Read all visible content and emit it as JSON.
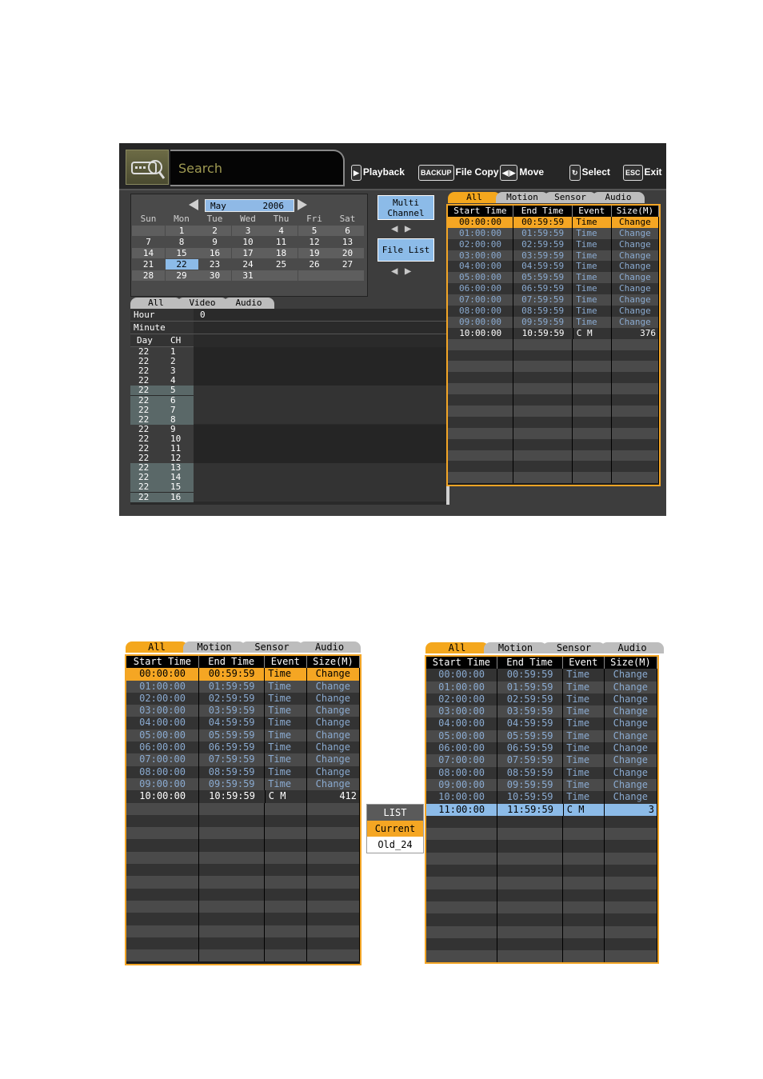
{
  "header": {
    "title": "Search",
    "hints": [
      {
        "key": "▶",
        "label": "Playback"
      },
      {
        "key": "BACKUP",
        "label": "File Copy"
      },
      {
        "key": "◀|▶",
        "label": "Move"
      },
      {
        "key": "↻",
        "label": "Select"
      },
      {
        "key": "ESC",
        "label": "Exit"
      }
    ]
  },
  "calendar": {
    "month": "May",
    "year": "2006",
    "weekdays": [
      "Sun",
      "Mon",
      "Tue",
      "Wed",
      "Thu",
      "Fri",
      "Sat"
    ],
    "weeks": [
      [
        "",
        "1",
        "2",
        "3",
        "4",
        "5",
        "6"
      ],
      [
        "7",
        "8",
        "9",
        "10",
        "11",
        "12",
        "13"
      ],
      [
        "14",
        "15",
        "16",
        "17",
        "18",
        "19",
        "20"
      ],
      [
        "21",
        "22",
        "23",
        "24",
        "25",
        "26",
        "27"
      ],
      [
        "28",
        "29",
        "30",
        "31",
        "",
        "",
        ""
      ]
    ],
    "selected": "22"
  },
  "buttons": {
    "multi_channel": "Multi Channel",
    "file_list": "File List"
  },
  "timeline": {
    "tabs": [
      "All",
      "Video",
      "Audio"
    ],
    "hour_label": "Hour",
    "hour_value": "0",
    "minute_label": "Minute",
    "day_label": "Day",
    "ch_label": "CH",
    "day": "22",
    "channels": [
      "1",
      "2",
      "3",
      "4",
      "5",
      "6",
      "7",
      "8",
      "9",
      "10",
      "11",
      "12",
      "13",
      "14",
      "15",
      "16"
    ]
  },
  "file_list_tabs": [
    "All",
    "Motion",
    "Sensor",
    "Audio"
  ],
  "columns": [
    "Start Time",
    "End Time",
    "Event",
    "Size(M)"
  ],
  "screen_rows": [
    [
      "00:00:00",
      "00:59:59",
      "Time",
      "Change"
    ],
    [
      "01:00:00",
      "01:59:59",
      "Time",
      "Change"
    ],
    [
      "02:00:00",
      "02:59:59",
      "Time",
      "Change"
    ],
    [
      "03:00:00",
      "03:59:59",
      "Time",
      "Change"
    ],
    [
      "04:00:00",
      "04:59:59",
      "Time",
      "Change"
    ],
    [
      "05:00:00",
      "05:59:59",
      "Time",
      "Change"
    ],
    [
      "06:00:00",
      "06:59:59",
      "Time",
      "Change"
    ],
    [
      "07:00:00",
      "07:59:59",
      "Time",
      "Change"
    ],
    [
      "08:00:00",
      "08:59:59",
      "Time",
      "Change"
    ],
    [
      "09:00:00",
      "09:59:59",
      "Time",
      "Change"
    ],
    [
      "10:00:00",
      "10:59:59",
      "C M",
      "376"
    ]
  ],
  "left_rows": [
    [
      "00:00:00",
      "00:59:59",
      "Time",
      "Change"
    ],
    [
      "01:00:00",
      "01:59:59",
      "Time",
      "Change"
    ],
    [
      "02:00:00",
      "02:59:59",
      "Time",
      "Change"
    ],
    [
      "03:00:00",
      "03:59:59",
      "Time",
      "Change"
    ],
    [
      "04:00:00",
      "04:59:59",
      "Time",
      "Change"
    ],
    [
      "05:00:00",
      "05:59:59",
      "Time",
      "Change"
    ],
    [
      "06:00:00",
      "06:59:59",
      "Time",
      "Change"
    ],
    [
      "07:00:00",
      "07:59:59",
      "Time",
      "Change"
    ],
    [
      "08:00:00",
      "08:59:59",
      "Time",
      "Change"
    ],
    [
      "09:00:00",
      "09:59:59",
      "Time",
      "Change"
    ],
    [
      "10:00:00",
      "10:59:59",
      "C M",
      "412"
    ]
  ],
  "right_rows": [
    [
      "00:00:00",
      "00:59:59",
      "Time",
      "Change"
    ],
    [
      "01:00:00",
      "01:59:59",
      "Time",
      "Change"
    ],
    [
      "02:00:00",
      "02:59:59",
      "Time",
      "Change"
    ],
    [
      "03:00:00",
      "03:59:59",
      "Time",
      "Change"
    ],
    [
      "04:00:00",
      "04:59:59",
      "Time",
      "Change"
    ],
    [
      "05:00:00",
      "05:59:59",
      "Time",
      "Change"
    ],
    [
      "06:00:00",
      "06:59:59",
      "Time",
      "Change"
    ],
    [
      "07:00:00",
      "07:59:59",
      "Time",
      "Change"
    ],
    [
      "08:00:00",
      "08:59:59",
      "Time",
      "Change"
    ],
    [
      "09:00:00",
      "09:59:59",
      "Time",
      "Change"
    ],
    [
      "10:00:00",
      "10:59:59",
      "Time",
      "Change"
    ],
    [
      "11:00:00",
      "11:59:59",
      "C M",
      "3"
    ]
  ],
  "list_popup": {
    "title": "LIST",
    "items": [
      "Current",
      "Old_24"
    ]
  }
}
